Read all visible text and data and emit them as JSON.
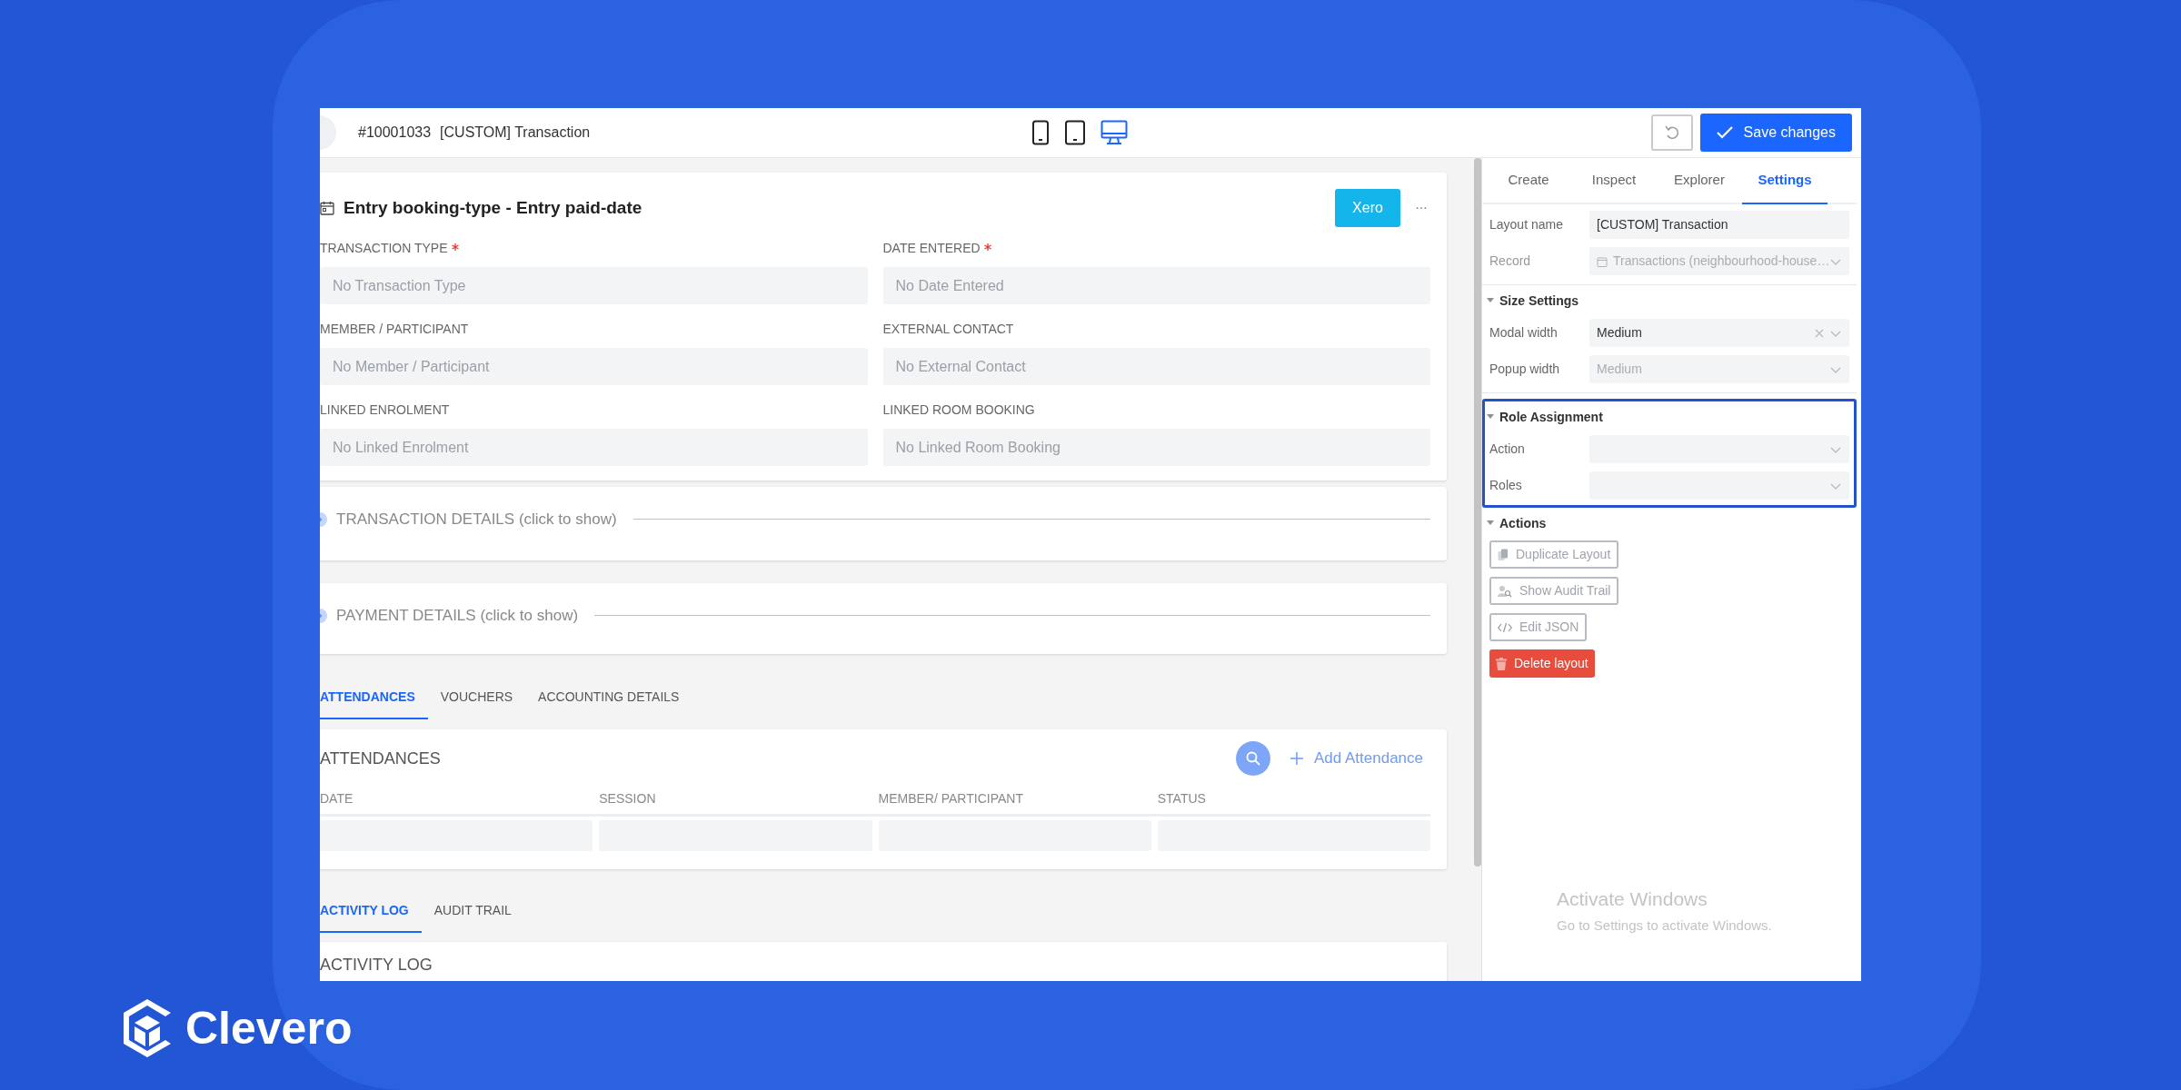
{
  "brand": {
    "name": "Clevero"
  },
  "top_bar": {
    "record_id": "#10001033",
    "title": "[CUSTOM] Transaction",
    "device_views": [
      {
        "kind": "phone",
        "selected": false
      },
      {
        "kind": "tablet",
        "selected": false
      },
      {
        "kind": "desktop",
        "selected": true
      }
    ],
    "save_button": "Save changes"
  },
  "form": {
    "title": "Entry booking-type - Entry paid-date",
    "xero_button": "Xero",
    "more_button": "···",
    "fields": [
      {
        "label": "TRANSACTION TYPE",
        "required": true,
        "placeholder": "No Transaction Type"
      },
      {
        "label": "DATE ENTERED",
        "required": true,
        "placeholder": "No Date Entered"
      },
      {
        "label": "MEMBER / PARTICIPANT",
        "required": false,
        "placeholder": "No Member / Participant"
      },
      {
        "label": "EXTERNAL CONTACT",
        "required": false,
        "placeholder": "No External Contact"
      },
      {
        "label": "LINKED ENROLMENT",
        "required": false,
        "placeholder": "No Linked Enrolment"
      },
      {
        "label": "LINKED ROOM BOOKING",
        "required": false,
        "placeholder": "No Linked Room Booking"
      }
    ]
  },
  "sections": [
    {
      "label": "TRANSACTION DETAILS (click to show)"
    },
    {
      "label": "PAYMENT DETAILS (click to show)"
    }
  ],
  "related_tabs": [
    {
      "label": "ATTENDANCES",
      "selected": true
    },
    {
      "label": "VOUCHERS",
      "selected": false
    },
    {
      "label": "ACCOUNTING DETAILS",
      "selected": false
    }
  ],
  "attendances": {
    "title": "ATTENDANCES",
    "add_button": "Add Attendance",
    "columns": [
      "DATE",
      "SESSION",
      "MEMBER/ PARTICIPANT",
      "STATUS"
    ]
  },
  "log_tabs": [
    {
      "label": "ACTIVITY LOG",
      "selected": true
    },
    {
      "label": "AUDIT TRAIL",
      "selected": false
    }
  ],
  "activity_log": {
    "title": "ACTIVITY LOG"
  },
  "panel": {
    "tabs": [
      {
        "label": "Create",
        "selected": false
      },
      {
        "label": "Inspect",
        "selected": false
      },
      {
        "label": "Explorer",
        "selected": false
      },
      {
        "label": "Settings",
        "selected": true
      }
    ],
    "settings": [
      {
        "label": "Layout name",
        "value": "[CUSTOM] Transaction",
        "kind": "text",
        "disabled": false
      },
      {
        "label": "Record",
        "value": "Transactions (neighbourhood-house…",
        "kind": "record",
        "disabled": true
      }
    ],
    "groups": [
      {
        "title": "Size Settings",
        "highlighted": false,
        "rows": [
          {
            "label": "Modal width",
            "value": "Medium",
            "clearable": true,
            "disabled": false
          },
          {
            "label": "Popup width",
            "value": "Medium",
            "clearable": false,
            "disabled": true
          }
        ]
      },
      {
        "title": "Role Assignment",
        "highlighted": true,
        "rows": [
          {
            "label": "Action",
            "clearable": false
          },
          {
            "label": "Roles",
            "clearable": false
          }
        ]
      }
    ],
    "actions": {
      "title": "Actions",
      "buttons": [
        {
          "label": "Duplicate Layout",
          "kind": "copy"
        },
        {
          "label": "Show Audit Trail",
          "kind": "audit"
        },
        {
          "label": "Edit JSON",
          "kind": "code"
        },
        {
          "label": "Delete layout",
          "kind": "delete"
        }
      ]
    }
  },
  "activation_notice": {
    "title": "Activate Windows",
    "message": "Go to Settings to activate Windows."
  }
}
